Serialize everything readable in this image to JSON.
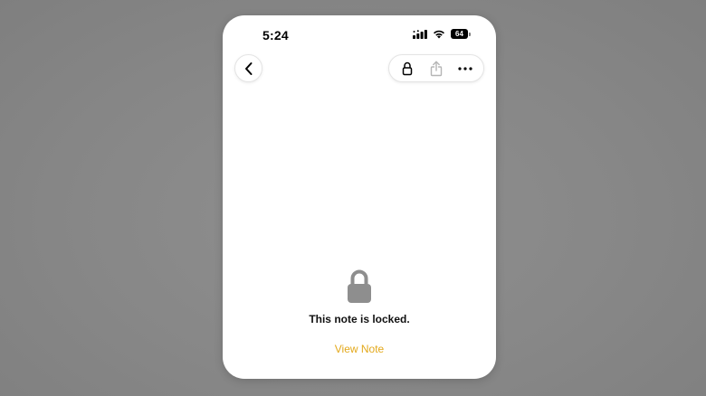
{
  "status_bar": {
    "time": "5:24",
    "battery_level": "64",
    "icons": [
      "signal-icon",
      "wifi-icon",
      "battery-icon"
    ]
  },
  "nav": {
    "back_icon": "chevron-left-icon",
    "toolbar_icons": [
      "lock-icon",
      "share-icon",
      "more-icon"
    ]
  },
  "locked_note": {
    "icon": "lock-icon",
    "message": "This note is locked.",
    "view_note_label": "View Note"
  },
  "colors": {
    "background": "#888888",
    "card": "#ffffff",
    "accent": "#e3a81a",
    "lock_gray": "#8e8e8e",
    "share_disabled": "#b5b5b5"
  }
}
